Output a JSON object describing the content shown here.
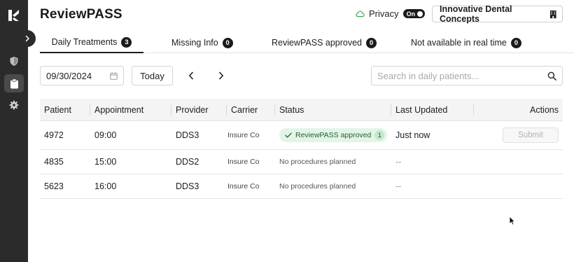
{
  "app": {
    "title": "ReviewPASS"
  },
  "header": {
    "privacy_label": "Privacy",
    "privacy_toggle": "On",
    "org_name": "Innovative Dental Concepts",
    "org_icon": "building-icon",
    "cloud_icon": "cloud-icon"
  },
  "sidebar": {
    "items": [
      {
        "icon": "shield-icon",
        "active": false
      },
      {
        "icon": "clipboard-icon",
        "active": true
      },
      {
        "icon": "gear-icon",
        "active": false
      }
    ]
  },
  "tabs": [
    {
      "label": "Daily Treatments",
      "count": "3",
      "active": true
    },
    {
      "label": "Missing Info",
      "count": "0",
      "active": false
    },
    {
      "label": "ReviewPASS approved",
      "count": "0",
      "active": false
    },
    {
      "label": "Not available in real time",
      "count": "0",
      "active": false
    }
  ],
  "toolbar": {
    "date_value": "09/30/2024",
    "today_label": "Today",
    "search_placeholder": "Search in daily patients..."
  },
  "table": {
    "columns": [
      "Patient",
      "Appointment",
      "Provider",
      "Carrier",
      "Status",
      "Last Updated",
      "Actions"
    ],
    "rows": [
      {
        "patient": "4972",
        "appointment": "09:00",
        "provider": "DDS3",
        "carrier": "Insure Co",
        "status": "ReviewPASS approved",
        "status_count": "1",
        "last_updated": "Just now",
        "action": "Submit"
      },
      {
        "patient": "4835",
        "appointment": "15:00",
        "provider": "DDS2",
        "carrier": "Insure Co",
        "status": "No procedures planned",
        "last_updated": "--"
      },
      {
        "patient": "5623",
        "appointment": "16:00",
        "provider": "DDS3",
        "carrier": "Insure Co",
        "status": "No procedures planned",
        "last_updated": "--"
      }
    ]
  },
  "colors": {
    "sidebar_bg": "#2b2b2b",
    "approved_bg": "#e3f5e6",
    "approved_text": "#245c2f",
    "cloud_green": "#3aa655"
  }
}
